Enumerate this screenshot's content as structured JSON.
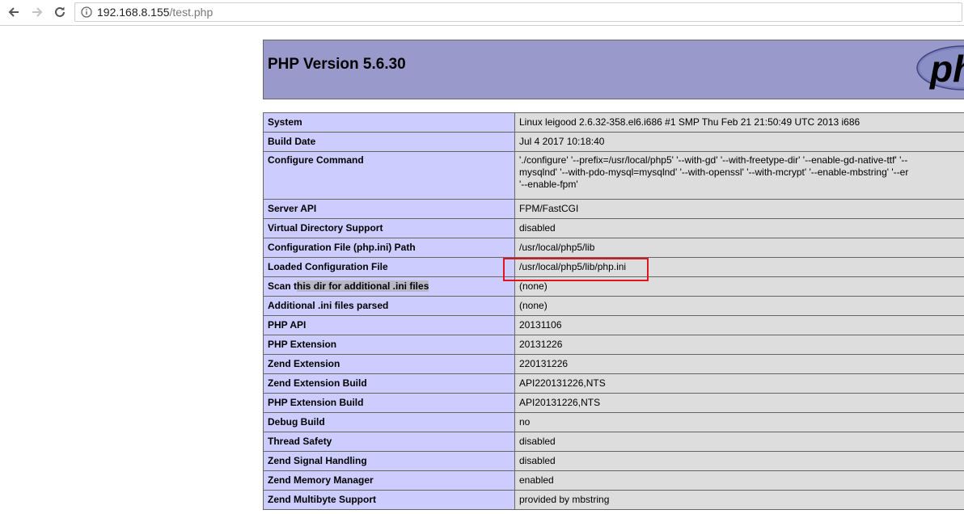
{
  "browser": {
    "url_host": "192.168.8.155",
    "url_path": "/test.php"
  },
  "php": {
    "title": "PHP Version 5.6.30",
    "logo_text": "php"
  },
  "rows": [
    {
      "label": "System",
      "value": "Linux leigood 2.6.32-358.el6.i686 #1 SMP Thu Feb 21 21:50:49 UTC 2013 i686"
    },
    {
      "label": "Build Date",
      "value": "Jul 4 2017 10:18:40"
    },
    {
      "label": "Configure Command",
      "value_lines": [
        "'./configure' '--prefix=/usr/local/php5' '--with-gd' '--with-freetype-dir' '--enable-gd-native-ttf' '--",
        "mysqlnd' '--with-pdo-mysql=mysqlnd' '--with-openssl' '--with-mcrypt' '--enable-mbstring' '--er",
        "'--enable-fpm'"
      ]
    },
    {
      "label": "Server API",
      "value": "FPM/FastCGI"
    },
    {
      "label": "Virtual Directory Support",
      "value": "disabled"
    },
    {
      "label": "Configuration File (php.ini) Path",
      "value": "/usr/local/php5/lib"
    },
    {
      "label": "Loaded Configuration File",
      "value": "/usr/local/php5/lib/php.ini"
    },
    {
      "label_pre": "Scan t",
      "label_hl": "his dir for additional .ini files",
      "value": "(none)"
    },
    {
      "label": "Additional .ini files parsed",
      "value": "(none)"
    },
    {
      "label": "PHP API",
      "value": "20131106"
    },
    {
      "label": "PHP Extension",
      "value": "20131226"
    },
    {
      "label": "Zend Extension",
      "value": "220131226"
    },
    {
      "label": "Zend Extension Build",
      "value": "API220131226,NTS"
    },
    {
      "label": "PHP Extension Build",
      "value": "API20131226,NTS"
    },
    {
      "label": "Debug Build",
      "value": "no"
    },
    {
      "label": "Thread Safety",
      "value": "disabled"
    },
    {
      "label": "Zend Signal Handling",
      "value": "disabled"
    },
    {
      "label": "Zend Memory Manager",
      "value": "enabled"
    },
    {
      "label": "Zend Multibyte Support",
      "value": "provided by mbstring"
    }
  ],
  "colors": {
    "header_bg": "#9999cc",
    "label_bg": "#ccccff",
    "value_bg": "#dddddd",
    "highlight_box": "#e0141e"
  },
  "icons": [
    "back-arrow-icon",
    "forward-arrow-icon",
    "reload-icon",
    "info-icon"
  ]
}
